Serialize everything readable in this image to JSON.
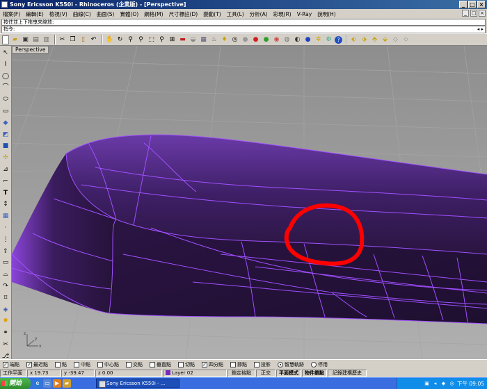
{
  "window": {
    "title": "Sony Ericsson K550i - Rhinoceros (企業版) - [Perspective]",
    "controls": [
      "_",
      "□",
      "×"
    ]
  },
  "menu": {
    "items": [
      "檔案(F)",
      "編輯(E)",
      "檢視(V)",
      "曲線(C)",
      "曲面(S)",
      "實體(O)",
      "網格(M)",
      "尺寸標註(D)",
      "變動(T)",
      "工具(L)",
      "分析(A)",
      "彩現(R)",
      "V-Ray",
      "說明(H)"
    ]
  },
  "command": {
    "history": "按住並上下拖曳來縮放:",
    "prompt": "指令:",
    "arrows": "◂ ▸"
  },
  "toolbar": {
    "icons": [
      "new-icon",
      "open-icon",
      "save-icon",
      "print-icon",
      "import-icon",
      "cut-icon",
      "copy-icon",
      "paste-icon",
      "undo-icon",
      "pan-icon",
      "rotate-view-icon",
      "zoom-dynamic-icon",
      "zoom-window-icon",
      "zoom-extents-icon",
      "zoom-selected-icon",
      "viewport-layout-icon",
      "car-icon",
      "layer-icon",
      "properties-icon",
      "light-icon",
      "bulb-icon",
      "wireframe-icon",
      "ghosted-icon",
      "shaded-icon",
      "rendered-icon",
      "color-wheel-icon",
      "material-icon",
      "environment-icon",
      "sphere-render-icon",
      "gear-icon",
      "settings-icon",
      "help-icon",
      "snap1-icon",
      "snap2-icon",
      "snap3-icon",
      "snap4-icon",
      "snap5-icon",
      "snap6-icon"
    ]
  },
  "left_toolbar": {
    "icons": [
      "select-icon",
      "polyline-icon",
      "circle-icon",
      "arc-icon",
      "ellipse-icon",
      "rectangle-icon",
      "surface-icon",
      "box-icon",
      "solid-icon",
      "transform-icon",
      "mirror-icon",
      "fillet-icon",
      "text-icon",
      "dimension-icon",
      "array-icon",
      "point-icon",
      "grid-icon",
      "extrude-icon",
      "loft-icon",
      "rail-icon",
      "curve-icon",
      "offset-icon",
      "boolean-icon",
      "explode-icon",
      "join-icon",
      "split-icon",
      "trim-icon",
      "analyze-icon"
    ]
  },
  "viewport": {
    "label": "Perspective"
  },
  "osnap": {
    "items": [
      {
        "label": "端點",
        "checked": true
      },
      {
        "label": "最近點",
        "checked": true
      },
      {
        "label": "點",
        "checked": false
      },
      {
        "label": "中點",
        "checked": false
      },
      {
        "label": "中心點",
        "checked": false
      },
      {
        "label": "交點",
        "checked": false
      },
      {
        "label": "垂直點",
        "checked": false
      },
      {
        "label": "切點",
        "checked": false
      },
      {
        "label": "四分點",
        "checked": true
      },
      {
        "label": "節點",
        "checked": false
      },
      {
        "label": "投影",
        "checked": false
      }
    ],
    "radio": [
      {
        "label": "智慧軌跡",
        "on": true
      },
      {
        "label": "停用",
        "on": false
      }
    ]
  },
  "status": {
    "cplane": "工作平面",
    "x": "x 19.73",
    "y": "y -39.47",
    "z": "z 0.00",
    "layer": "Layer 02",
    "grid_snap": "鎖定格點",
    "ortho": "正交",
    "planar": "平面模式",
    "osnap_toggle": "物件鎖點",
    "history": "記錄建構歷史",
    "layer_color": "#7a2bbf"
  },
  "taskbar": {
    "start": "開始",
    "task": "Sony Ericsson K550i - ...",
    "clock": "下午 09:05"
  }
}
